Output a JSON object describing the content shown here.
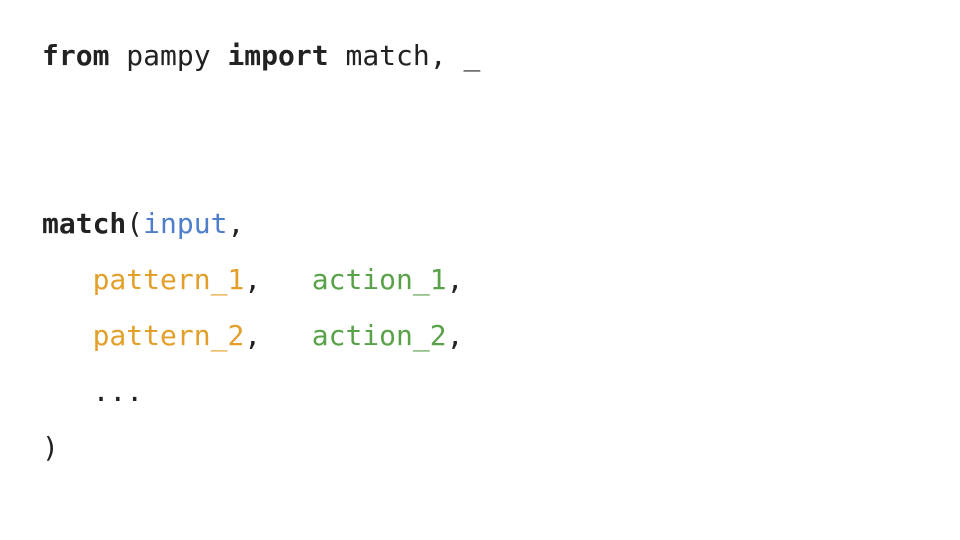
{
  "code": {
    "kw_from": "from",
    "module": " pampy ",
    "kw_import": "import",
    "imports": " match, _",
    "fn_match": "match",
    "open_paren": "(",
    "input": "input",
    "comma": ",",
    "indent": "   ",
    "pattern1": "pattern_1",
    "gap": ",   ",
    "action1": "action_1",
    "pattern2": "pattern_2",
    "action2": "action_2",
    "ellipsis": "...",
    "close_paren": ")"
  }
}
